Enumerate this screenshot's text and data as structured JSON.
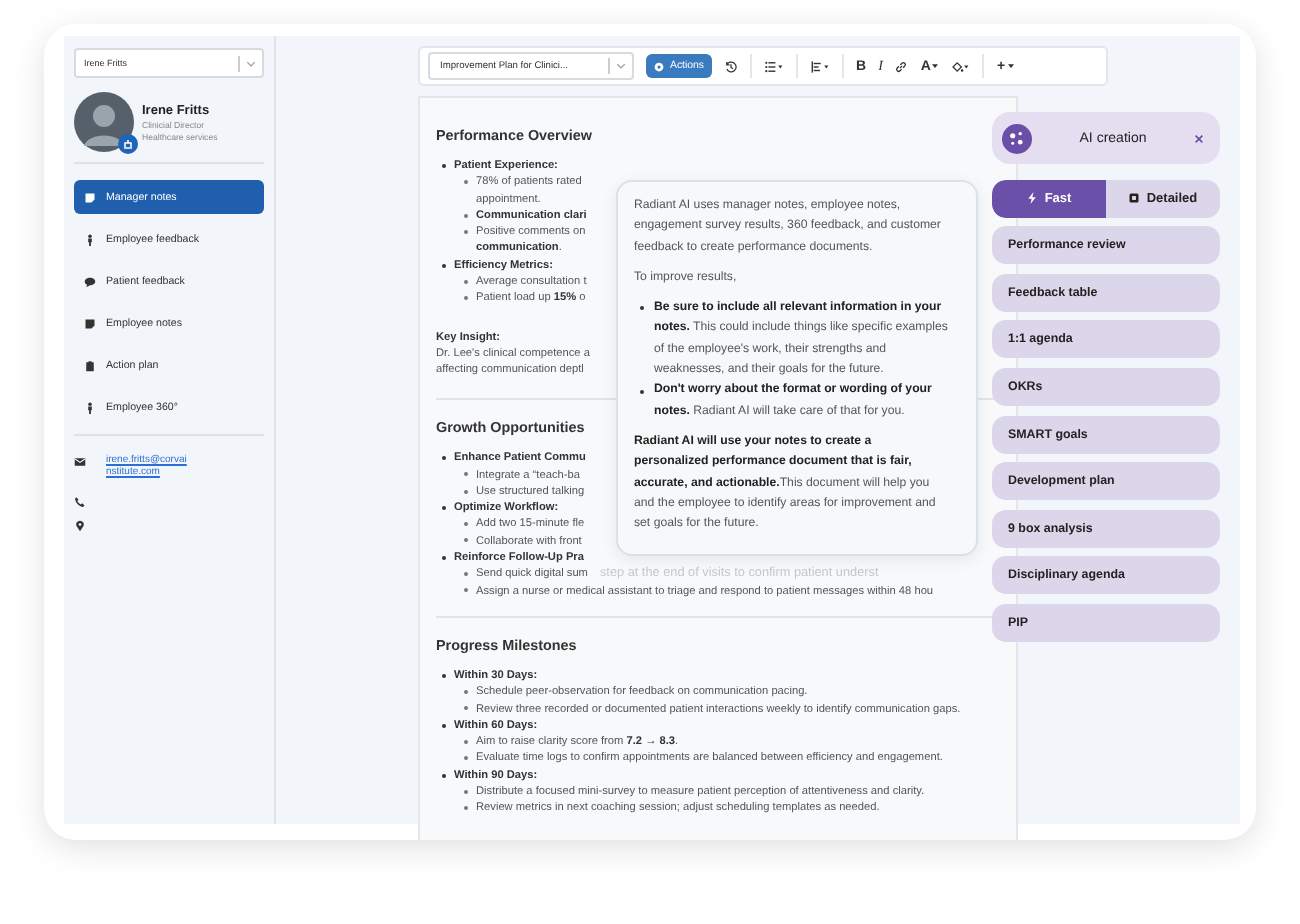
{
  "sidebar": {
    "selector": "Irene Fritts",
    "profile": {
      "name": "Irene Fritts",
      "role": "Clinicial Director",
      "department": "Healthcare services"
    },
    "nav": [
      {
        "label": "Manager notes",
        "selected": true
      },
      {
        "label": "Employee feedback",
        "selected": false
      },
      {
        "label": "Patient feedback",
        "selected": false
      },
      {
        "label": "Employee notes",
        "selected": false
      },
      {
        "label": "Action plan",
        "selected": false
      },
      {
        "label": "Employee 360°",
        "selected": false
      }
    ],
    "email": "irene.fritts@corvainstitute.com"
  },
  "toolbar": {
    "document_title": "Improvement Plan for Clinici...",
    "actions": "Actions",
    "bold": "B",
    "italic": "I",
    "text_color": "A",
    "insert": "+"
  },
  "document": {
    "sections": [
      {
        "heading": "Performance Overview",
        "items": [
          {
            "label": "Patient Experience:",
            "children": [
              {
                "lines": [
                  "78% of patients rated",
                  "appointment."
                ],
                "bold": false
              },
              {
                "lines": [
                  "Communication clari"
                ],
                "bold": true
              },
              {
                "lines": [
                  "Positive comments on",
                  "**communication**."
                ],
                "bold": false
              }
            ]
          },
          {
            "label": "Efficiency Metrics:",
            "children": [
              {
                "lines": [
                  "Average consultation t"
                ],
                "bold": false
              },
              {
                "lines": [
                  "Patient load up **15%** o"
                ],
                "bold": false
              }
            ]
          }
        ],
        "insight": {
          "label": "Key Insight:",
          "lines": [
            "Dr. Lee's clinical competence a",
            "affecting communication deptl"
          ]
        }
      },
      {
        "heading": "Growth Opportunities",
        "items": [
          {
            "label": "Enhance Patient Commu",
            "children": [
              {
                "lines": [
                  "Integrate a “teach-ba"
                ],
                "bold": false
              },
              {
                "lines": [
                  "Use structured talking"
                ],
                "bold": false
              }
            ]
          },
          {
            "label": "Optimize Workflow:",
            "children": [
              {
                "lines": [
                  "Add two 15-minute fle"
                ],
                "bold": false
              },
              {
                "lines": [
                  "Collaborate with front"
                ],
                "bold": false
              }
            ]
          },
          {
            "label": "Reinforce Follow-Up Pra",
            "children": [
              {
                "lines": [
                  "Send quick digital sum"
                ],
                "faded": "step at the end of visits to confirm patient underst",
                "bold": false
              },
              {
                "lines": [
                  "Assign a nurse or medical assistant to triage and respond to patient messages within 48 hou"
                ],
                "bold": false
              }
            ]
          }
        ]
      },
      {
        "heading": "Progress Milestones",
        "items": [
          {
            "label": "Within 30 Days:",
            "children": [
              {
                "lines": [
                  "Schedule peer-observation for feedback on communication pacing."
                ],
                "bold": false
              },
              {
                "lines": [
                  "Review three recorded or documented patient interactions weekly to identify communication gaps."
                ],
                "bold": false
              }
            ]
          },
          {
            "label": "Within 60 Days:",
            "children": [
              {
                "lines": [
                  "Aim to raise clarity score from **7.2 → 8.3**."
                ],
                "bold": false
              },
              {
                "lines": [
                  "Evaluate time logs to confirm appointments are balanced between efficiency and engagement."
                ],
                "bold": false
              }
            ]
          },
          {
            "label": "Within 90 Days:",
            "children": [
              {
                "lines": [
                  "Distribute a focused mini-survey to measure patient perception of attentiveness and clarity."
                ],
                "bold": false
              },
              {
                "lines": [
                  "Review metrics in next coaching session; adjust scheduling templates as needed."
                ],
                "bold": false
              }
            ]
          }
        ]
      }
    ]
  },
  "info_popup": {
    "intro": "Radiant AI uses manager notes, employee notes, engagement survey results, 360 feedback, and customer feedback to create performance documents.",
    "lead": "To improve results,",
    "tips": [
      "**Be sure to include all relevant information in your notes.** This could include things like specific examples of the employee's work, their strengths and weaknesses, and their goals for the future.",
      "**Don't worry about the format or wording of your notes.** Radiant AI will take care of that for you."
    ],
    "summary": "**Radiant AI will use your notes to create a personalized performance document that is fair, accurate, and actionable.**This document will help you and the employee to identify areas for improvement and set goals for the future."
  },
  "ai_panel": {
    "title": "AI creation",
    "modes": [
      {
        "label": "Fast",
        "selected": true
      },
      {
        "label": "Detailed",
        "selected": false
      }
    ],
    "options": [
      "Performance review",
      "Feedback table",
      "1:1 agenda",
      "OKRs",
      "SMART goals",
      "Development plan",
      "9 box analysis",
      "Disciplinary agenda",
      "PIP"
    ]
  }
}
